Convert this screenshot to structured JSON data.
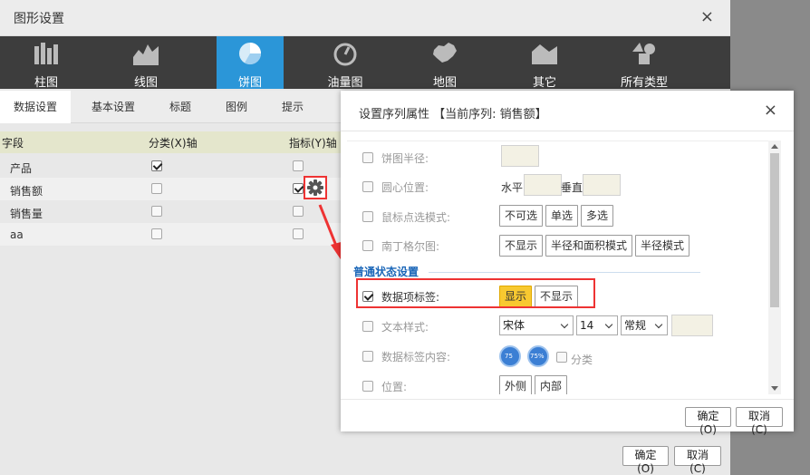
{
  "main": {
    "title": "图形设置",
    "close": "×",
    "type_tabs": [
      {
        "label": "柱图",
        "icon": "bar-chart-icon"
      },
      {
        "label": "线图",
        "icon": "line-chart-icon"
      },
      {
        "label": "饼图",
        "icon": "pie-chart-icon",
        "active": true
      },
      {
        "label": "油量图",
        "icon": "gauge-icon"
      },
      {
        "label": "地图",
        "icon": "map-icon"
      },
      {
        "label": "其它",
        "icon": "other-chart-icon"
      },
      {
        "label": "所有类型",
        "icon": "all-types-icon"
      }
    ],
    "sub_tabs": [
      "数据设置",
      "基本设置",
      "标题",
      "图例",
      "提示"
    ],
    "grid": {
      "headers": [
        "字段",
        "分类(X)轴",
        "指标(Y)轴"
      ],
      "rows": [
        {
          "name": "产品",
          "x": true,
          "y": false
        },
        {
          "name": "销售额",
          "x": false,
          "y": true
        },
        {
          "name": "销售量",
          "x": false,
          "y": false
        },
        {
          "name": "aa",
          "x": false,
          "y": false
        }
      ]
    },
    "ok": "确定(O)",
    "cancel": "取消(C)"
  },
  "series_dialog": {
    "title": "设置序列属性 【当前序列: 销售额】",
    "close": "×",
    "rows": {
      "radius": {
        "label": "饼图半径:"
      },
      "center": {
        "label": "圆心位置:",
        "horizontal": "水平",
        "vertical": "垂直"
      },
      "click_mode": {
        "label": "鼠标点选模式:",
        "options": [
          "不可选",
          "单选",
          "多选"
        ]
      },
      "nightingale": {
        "label": "南丁格尔图:",
        "options": [
          "不显示",
          "半径和面积模式",
          "半径模式"
        ]
      },
      "section": "普通状态设置",
      "data_label": {
        "label": "数据项标签:",
        "checked": true,
        "options": [
          "显示",
          "不显示"
        ],
        "selected": "显示"
      },
      "text_style": {
        "label": "文本样式:",
        "font": "宋体",
        "size": "14",
        "weight": "常规"
      },
      "label_content": {
        "label": "数据标签内容:",
        "icon1": "75",
        "icon2": "75%",
        "category": "分类"
      },
      "position": {
        "label": "位置:",
        "options": [
          "外侧",
          "内部"
        ]
      }
    },
    "ok": "确定(O)",
    "cancel": "取消(C)"
  },
  "colors": {
    "active_tab": "#2b96d8",
    "highlight": "#e33333",
    "yellow": "#f8c930",
    "section": "#1a66b8"
  }
}
